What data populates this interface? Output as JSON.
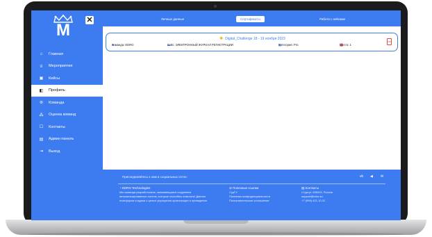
{
  "sidebar": {
    "logo_letter": "M",
    "items": [
      {
        "label": "Главная",
        "icon": "home-icon",
        "glyph": "⌂"
      },
      {
        "label": "Мероприятия",
        "icon": "trophy-icon",
        "glyph": "♕"
      },
      {
        "label": "Кейсы",
        "icon": "briefcase-icon",
        "glyph": "▣"
      },
      {
        "label": "Профиль",
        "icon": "profile-icon",
        "glyph": "◧",
        "active": true
      },
      {
        "label": "Команда",
        "icon": "team-icon",
        "glyph": "⊚"
      },
      {
        "label": "Оценка команд",
        "icon": "rating-icon",
        "glyph": "⁂"
      },
      {
        "label": "Контакты",
        "icon": "contacts-icon",
        "glyph": "☐"
      },
      {
        "label": "Админ панель",
        "icon": "admin-icon",
        "glyph": "▤"
      },
      {
        "label": "Выход",
        "icon": "logout-icon",
        "glyph": "⇥"
      }
    ]
  },
  "topnav": {
    "tabs": [
      {
        "label": "Личные данные"
      },
      {
        "label": "Сертификаты",
        "active": true
      },
      {
        "label": "Работа с кейсами"
      }
    ]
  },
  "certificate": {
    "title": "Digital_Challenge 18 - 19 ноября 2023",
    "team": "Команда: EDRO",
    "case": "Кейс: ЭЛЕКТРОННЫЙ ЖУРНАЛ РЕГИСТРАЦИИ",
    "category": "Категория: Pro",
    "place": "Место: 1",
    "pdf_label": "PDF"
  },
  "footer": {
    "join_text": "Присоединяйтесь к нам в социальных сетях:",
    "social": [
      {
        "icon": "vk-icon",
        "glyph": "vk"
      },
      {
        "icon": "telegram-icon",
        "glyph": "◀"
      },
      {
        "icon": "mail-icon",
        "glyph": "✉"
      }
    ],
    "about": {
      "heading": "EDRO Technologies",
      "line1": "Мы команда разработчиков, занимающаяся созданием",
      "line2": "автоматизированных систем, которые способны помогать! Данная",
      "line3": "платформа создана с целью упрощения организации и проведения"
    },
    "links": {
      "heading": "Полезные ссылки",
      "line1": "СурГУ",
      "line2": "Политика конфиденциальности",
      "line3": "Пользовательское соглашение"
    },
    "contacts": {
      "heading": "Контакты",
      "line1": "г.Сургут, 628415, Россия",
      "line2": "support@edro.su",
      "line3": "+7 (999) 421-10-31"
    }
  },
  "colors": {
    "accent": "#3d7cf0",
    "pdf": "#e14b4b",
    "sun": "#f5a623"
  }
}
